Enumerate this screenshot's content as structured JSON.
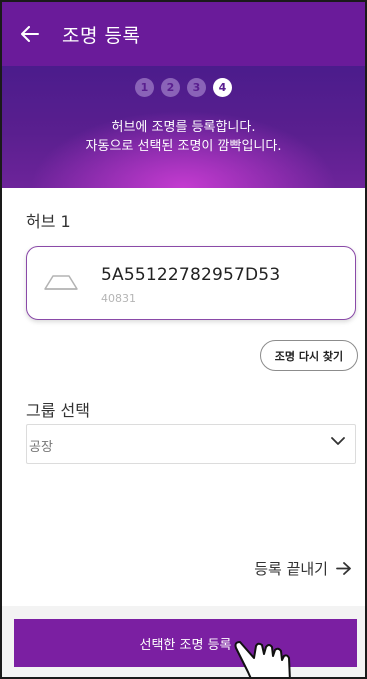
{
  "header": {
    "title": "조명 등록",
    "back_icon": "arrow-left-icon"
  },
  "banner": {
    "steps": [
      "1",
      "2",
      "3",
      "4"
    ],
    "active_step": 4,
    "line1": "허브에 조명를 등록합니다.",
    "line2": "자동으로 선택된 조명이 깜빡입니다."
  },
  "hub": {
    "label": "허브 1",
    "device": {
      "id": "5A55122782957D53",
      "sub": "40831",
      "icon": "lamp-icon"
    }
  },
  "rescan_button": "조명 다시 찾기",
  "group": {
    "label": "그룹 선택",
    "selected": "공장"
  },
  "finish_link": "등록 끝내기",
  "submit_button": "선택한 조명 등록",
  "colors": {
    "primary": "#7b1fa2",
    "appbar": "#6a1b9a"
  }
}
